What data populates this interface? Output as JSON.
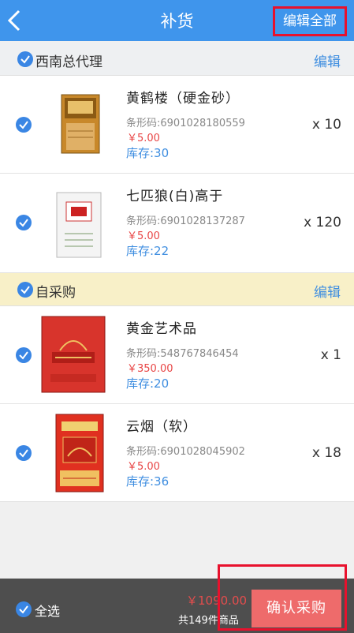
{
  "header": {
    "title": "补货",
    "edit_all": "编辑全部"
  },
  "groups": [
    {
      "name": "西南总代理",
      "edit": "编辑"
    },
    {
      "name": "自采购",
      "edit": "编辑"
    }
  ],
  "items": [
    {
      "name": "黄鹤楼（硬金砂）",
      "barcode": "条形码:6901028180559",
      "price": "￥5.00",
      "stock": "库存:30",
      "qty": "x 10"
    },
    {
      "name": "七匹狼(白)高于",
      "barcode": "条形码:6901028137287",
      "price": "￥5.00",
      "stock": "库存:22",
      "qty": "x 120"
    },
    {
      "name": "黄金艺术品",
      "barcode": "条形码:548767846454",
      "price": "￥350.00",
      "stock": "库存:20",
      "qty": "x 1"
    },
    {
      "name": "云烟（软）",
      "barcode": "条形码:6901028045902",
      "price": "￥5.00",
      "stock": "库存:36",
      "qty": "x 18"
    }
  ],
  "footer": {
    "select_all": "全选",
    "total": "￥1090.00",
    "count": "共149件商品",
    "confirm": "确认采购"
  },
  "icons": [
    "back-icon",
    "check-icon"
  ],
  "colors": {
    "primary": "#3f95ec",
    "price": "#e84545",
    "confirm": "#ee6b6b",
    "highlight": "#e8112d"
  }
}
